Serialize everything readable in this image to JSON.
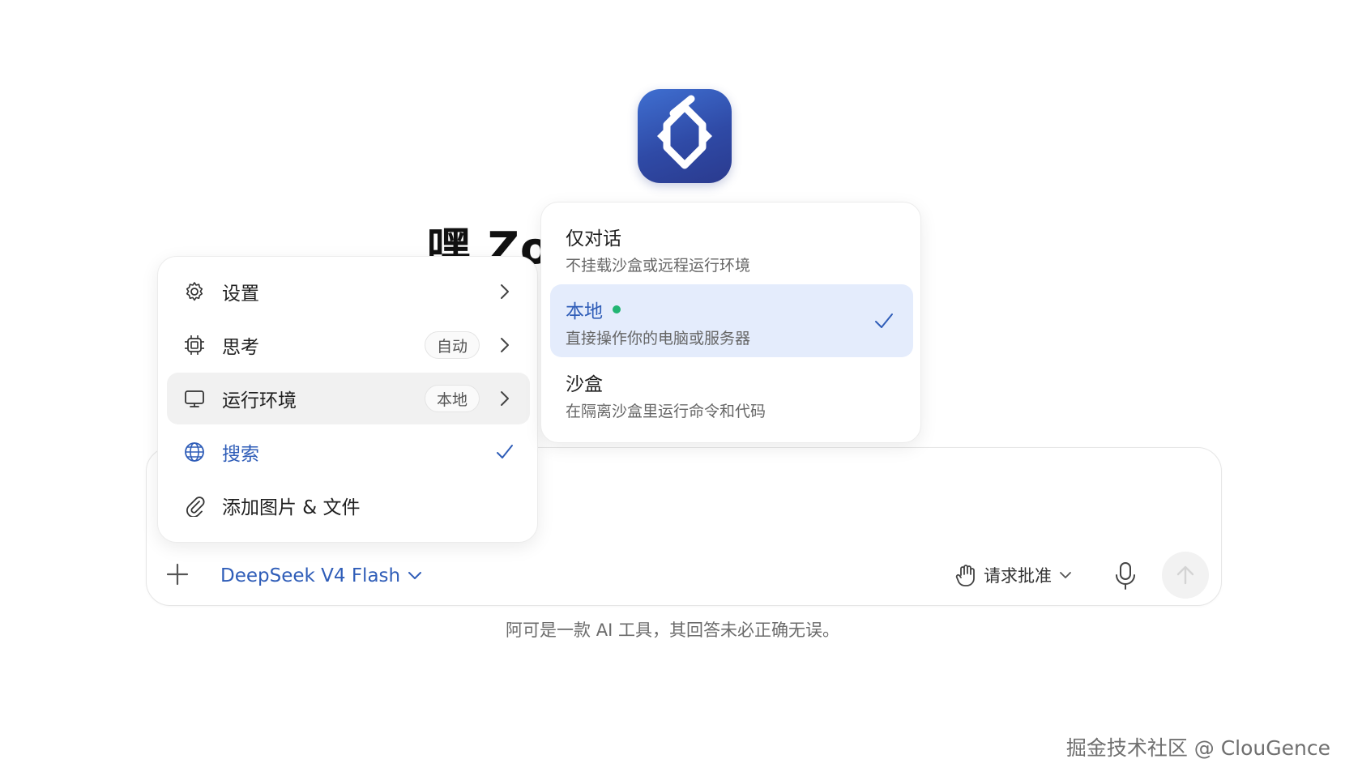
{
  "greeting": {
    "text": "嘿 Zoe"
  },
  "menu": {
    "items": [
      {
        "label": "设置",
        "icon": "gear-icon"
      },
      {
        "label": "思考",
        "icon": "chip-icon",
        "badge": "自动"
      },
      {
        "label": "运行环境",
        "icon": "monitor-icon",
        "badge": "本地"
      },
      {
        "label": "搜索",
        "icon": "globe-icon",
        "checked": true
      },
      {
        "label": "添加图片 & 文件",
        "icon": "paperclip-icon"
      }
    ]
  },
  "submenu": {
    "items": [
      {
        "title": "仅对话",
        "desc": "不挂载沙盒或远程运行环境"
      },
      {
        "title": "本地",
        "desc": "直接操作你的电脑或服务器",
        "selected": true,
        "status": "online"
      },
      {
        "title": "沙盒",
        "desc": "在隔离沙盒里运行命令和代码"
      }
    ]
  },
  "composer": {
    "model_label": "DeepSeek V4 Flash",
    "approval_label": "请求批准"
  },
  "disclaimer": "阿可是一款 AI 工具，其回答未必正确无误。",
  "watermark": "掘金技术社区 @ ClouGence",
  "colors": {
    "accent": "#2f5db8",
    "selected_bg": "#e4ecfc",
    "status_dot": "#22b573",
    "logo_gradient_start": "#3f6fd1",
    "logo_gradient_end": "#2a3a8e"
  }
}
